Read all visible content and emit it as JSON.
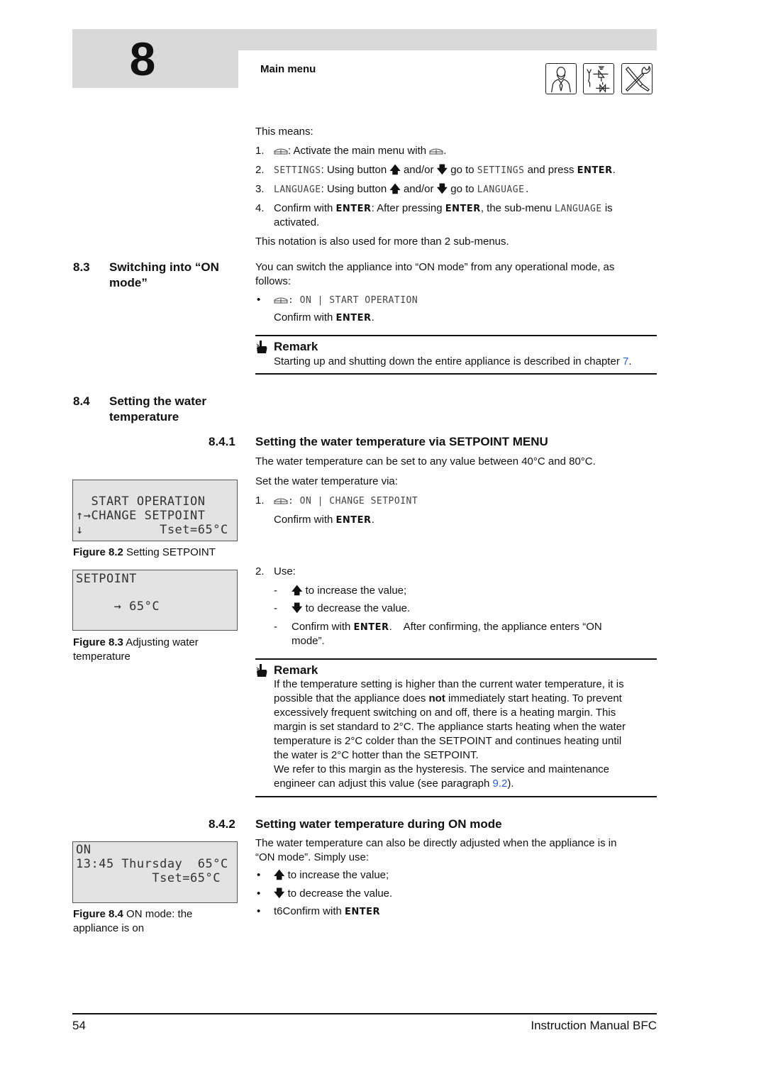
{
  "header": {
    "chapter_number": "8",
    "section_title": "Main menu",
    "icons": [
      "user-operator-icon",
      "installer-valve-icon",
      "service-tools-icon"
    ]
  },
  "intro": {
    "this_means": "This means:",
    "steps": [
      {
        "num": "1.",
        "pre": "",
        "text_a": ":  Activate the main menu with ",
        "text_b": "."
      },
      {
        "num": "2.",
        "lcd_a": "SETTINGS",
        "text_a": ": Using button ",
        "up": "🡅",
        "mid": " and/or ",
        "down": "🡇",
        "text_b": " go to ",
        "lcd_b": "SETTINGS",
        "text_c": " and press ",
        "enter": "ENTER",
        "text_d": "."
      },
      {
        "num": "3.",
        "lcd_a": "LANGUAGE",
        "text_a": ": Using button ",
        "up": "🡅",
        "mid": " and/or ",
        "down": "🡇",
        "text_b": " go to ",
        "lcd_b": "LANGUAGE."
      },
      {
        "num": "4.",
        "text_a": "Confirm with ",
        "enter": "ENTER",
        "text_b": ": After pressing ",
        "enter2": "ENTER",
        "text_c": ", the sub-menu ",
        "lcd_a": "LANGUAGE",
        "text_d": " is",
        "line2": "activated."
      }
    ],
    "note": "This notation is also used for more than 2 sub-menus."
  },
  "section_8_3": {
    "number": "8.3",
    "title_line1": "Switching into “ON",
    "title_line2": "mode”",
    "body_line1": "You can switch the appliance into “ON mode” from any operational mode, as",
    "body_line2": "follows:",
    "bullet": "•",
    "lcd_path": ": ON | START OPERATION",
    "confirm": "Confirm with ",
    "enter": "ENTER",
    "period": ".",
    "remark": {
      "title": "Remark",
      "text": "Starting up and shutting down the entire appliance is described in chapter ",
      "link": "7",
      "end": "."
    }
  },
  "section_8_4": {
    "number": "8.4",
    "title_line1": "Setting the water",
    "title_line2": "temperature"
  },
  "section_8_4_1": {
    "number": "8.4.1",
    "title": "Setting the water temperature via SETPOINT MENU",
    "body1": "The water temperature can be set to any value between 40°C and 80°C.",
    "body2": "Set the water temperature via:",
    "step1_num": "1.",
    "step1_lcd": ": ON | CHANGE SETPOINT",
    "step1_confirm": "Confirm with ",
    "enter": "ENTER",
    "period": ".",
    "step2_num": "2.",
    "step2_label": "Use:",
    "dash": "-",
    "up": "🡅",
    "down": "🡇",
    "increase": " to increase the value;",
    "decrease": " to decrease the value.",
    "confirm_line1_a": "Confirm with ",
    "confirm_line1_b": ".    After confirming, the appliance enters “ON",
    "confirm_line2": "mode”.",
    "remark": {
      "title": "Remark",
      "lines": [
        "If the temperature setting is higher than the current water temperature, it is",
        "immediately start heating. To prevent",
        "excessively frequent switching on and off, there is a heating margin. This",
        "margin is set standard to 2°C. The appliance starts heating when the water",
        "temperature is 2°C colder than the SETPOINT and continues heating until",
        "the water is 2°C hotter than the SETPOINT.",
        "We refer to this margin as the hysteresis. The service and maintenance",
        "engineer can adjust this value (see paragraph "
      ],
      "line2_pre": "possible that the appliance does ",
      "line2_bold": "not",
      "link": "9.2",
      "end": ")."
    }
  },
  "section_8_4_2": {
    "number": "8.4.2",
    "title": "Setting water temperature during ON mode",
    "body_line1": "The water temperature can also be directly adjusted when the appliance is in",
    "body_line2": "“ON mode”. Simply use:",
    "bullet": "•",
    "up": "🡅",
    "down": "🡇",
    "increase": " to increase the value;",
    "decrease": " to decrease the value.",
    "confirm": "t6Confirm with ",
    "enter": "ENTER"
  },
  "figures": {
    "fig_8_2": {
      "lines": [
        "  START OPERATION",
        "↑→CHANGE SETPOINT",
        "↓          Tset=65°C"
      ],
      "caption_bold": "Figure 8.2",
      "caption": " Setting SETPOINT"
    },
    "fig_8_3": {
      "lines": [
        "SETPOINT",
        "",
        "     → 65°C"
      ],
      "caption_bold": "Figure 8.3",
      "caption": " Adjusting water",
      "caption_line2": "temperature"
    },
    "fig_8_4": {
      "lines": [
        "ON",
        "13:45 Thursday  65°C",
        "          Tset=65°C"
      ],
      "caption_bold": "Figure 8.4",
      "caption": " ON mode: the",
      "caption_line2": "appliance is on"
    }
  },
  "footer": {
    "page_number": "54",
    "manual_title": "Instruction Manual BFC"
  }
}
